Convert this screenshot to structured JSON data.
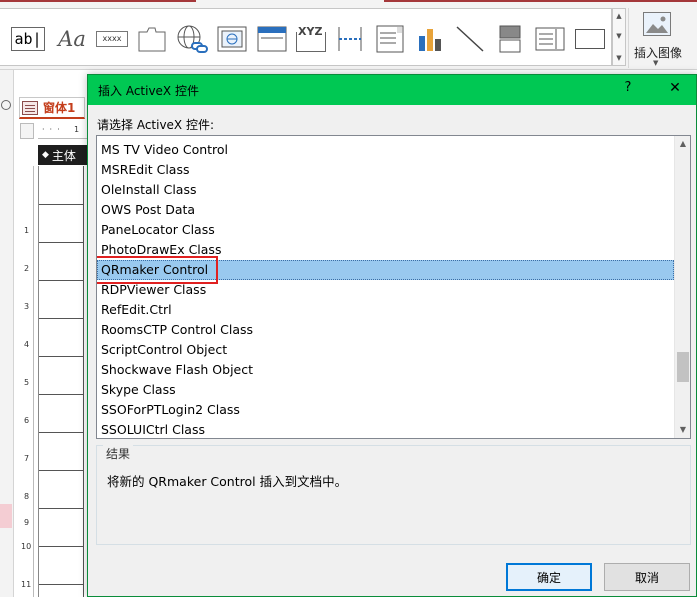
{
  "ribbon": {
    "controls": [
      "textbox-control",
      "label-control",
      "button-control",
      "tab-control",
      "hyperlink-control",
      "web-browser-control",
      "navigation-control",
      "option-group-control",
      "page-break-control",
      "combo-box-control",
      "chart-control",
      "line-control",
      "toggle-button-control",
      "list-box-control",
      "rectangle-control"
    ],
    "textbox_glyph": "ab|",
    "label_glyph": "Aa",
    "button_glyph": "xxxx",
    "option_group_glyph": "XYZ",
    "insert_image_label": "插入图像"
  },
  "form": {
    "tab_label": "窗体1",
    "section_label": "主体",
    "ruler_top_marks": [
      "1"
    ],
    "ruler_left_marks": [
      "1",
      "2",
      "3",
      "4",
      "5",
      "6",
      "7",
      "8",
      "9",
      "10",
      "11"
    ]
  },
  "dialog": {
    "title": "插入 ActiveX 控件",
    "help_glyph": "?",
    "close_glyph": "✕",
    "prompt": "请选择 ActiveX 控件:",
    "items": [
      "MS TV Video Control",
      "MSREdit Class",
      "OleInstall Class",
      "OWS Post Data",
      "PaneLocator Class",
      "PhotoDrawEx Class",
      "QRmaker Control",
      "RDPViewer Class",
      "RefEdit.Ctrl",
      "RoomsCTP Control Class",
      "ScriptControl Object",
      "Shockwave Flash Object",
      "Skype Class",
      "SSOForPTLogin2 Class",
      "SSOLUICtrl Class"
    ],
    "selected_item": "QRmaker Control",
    "result_legend": "结果",
    "result_text": "将新的 QRmaker Control 插入到文档中。",
    "ok_label": "确定",
    "cancel_label": "取消"
  },
  "colors": {
    "titlebar": "#00c853",
    "selection": "#99c9ef",
    "highlight_box": "#e02020",
    "accent_tab": "#c43e1c"
  }
}
